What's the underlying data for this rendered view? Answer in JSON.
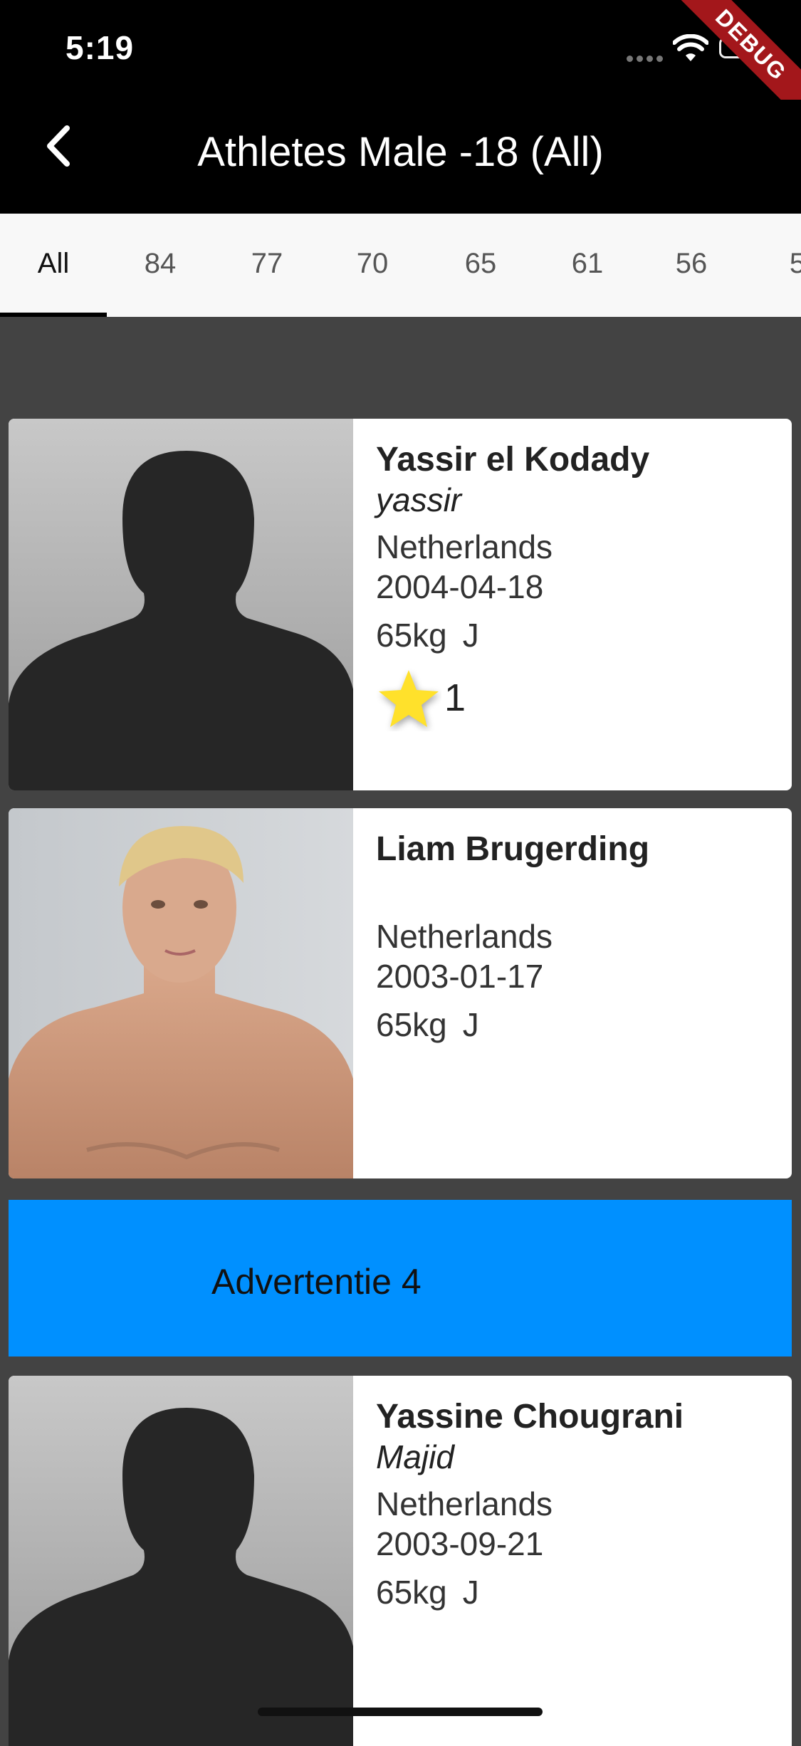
{
  "status": {
    "time": "5:19",
    "debug_label": "DEBUG"
  },
  "header": {
    "title": "Athletes Male -18 (All)"
  },
  "tabs": [
    {
      "label": "All",
      "active": true
    },
    {
      "label": "84"
    },
    {
      "label": "77"
    },
    {
      "label": "70"
    },
    {
      "label": "65"
    },
    {
      "label": "61"
    },
    {
      "label": "56"
    },
    {
      "label": "5"
    }
  ],
  "athletes": [
    {
      "name": "Yassir el Kodady",
      "nickname": "yassir",
      "country": "Netherlands",
      "dob": "2004-04-18",
      "weight": "65kg",
      "class": "J",
      "stars": "1",
      "photo": "silhouette-placeholder"
    },
    {
      "name": "Liam Brugerding",
      "nickname": "",
      "country": "Netherlands",
      "dob": "2003-01-17",
      "weight": "65kg",
      "class": "J",
      "photo": "athlete-photo"
    },
    {
      "name": "Yassine Chougrani",
      "nickname": "Majid",
      "country": "Netherlands",
      "dob": "2003-09-21",
      "weight": "65kg",
      "class": "J",
      "photo": "silhouette-placeholder"
    }
  ],
  "ad": {
    "label": "Advertentie 4"
  },
  "colors": {
    "accent_ad": "#0090ff",
    "star": "#ffe12b",
    "debug_ribbon": "#a3171b"
  }
}
